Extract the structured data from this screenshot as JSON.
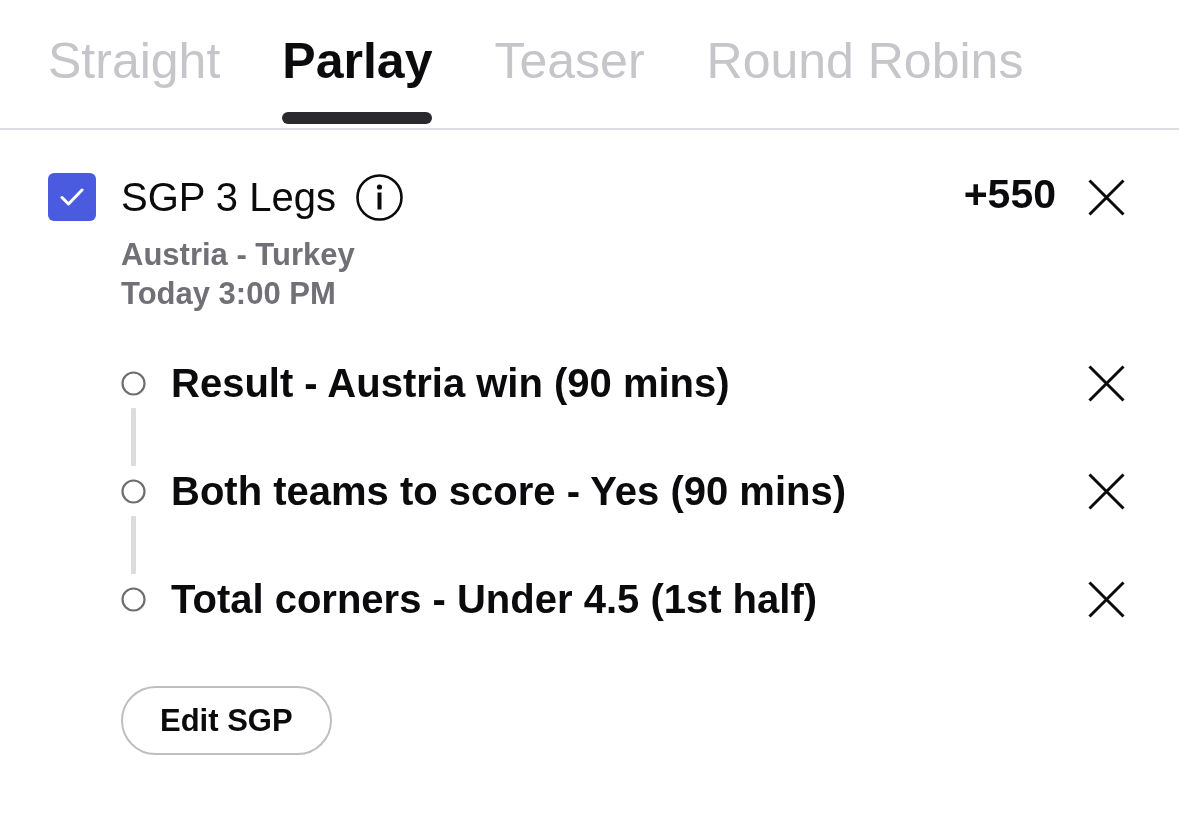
{
  "tabs": [
    {
      "label": "Straight",
      "selected": false
    },
    {
      "label": "Parlay",
      "selected": true
    },
    {
      "label": "Teaser",
      "selected": false
    },
    {
      "label": "Round Robins",
      "selected": false
    }
  ],
  "bet": {
    "checked": true,
    "title": "SGP 3 Legs",
    "odds": "+550",
    "match": "Austria - Turkey",
    "time": "Today 3:00 PM",
    "legs": [
      {
        "label": "Result - Austria win (90 mins)"
      },
      {
        "label": "Both teams to score - Yes (90 mins)"
      },
      {
        "label": "Total corners - Under 4.5 (1st half)"
      }
    ],
    "edit_button": "Edit SGP"
  }
}
